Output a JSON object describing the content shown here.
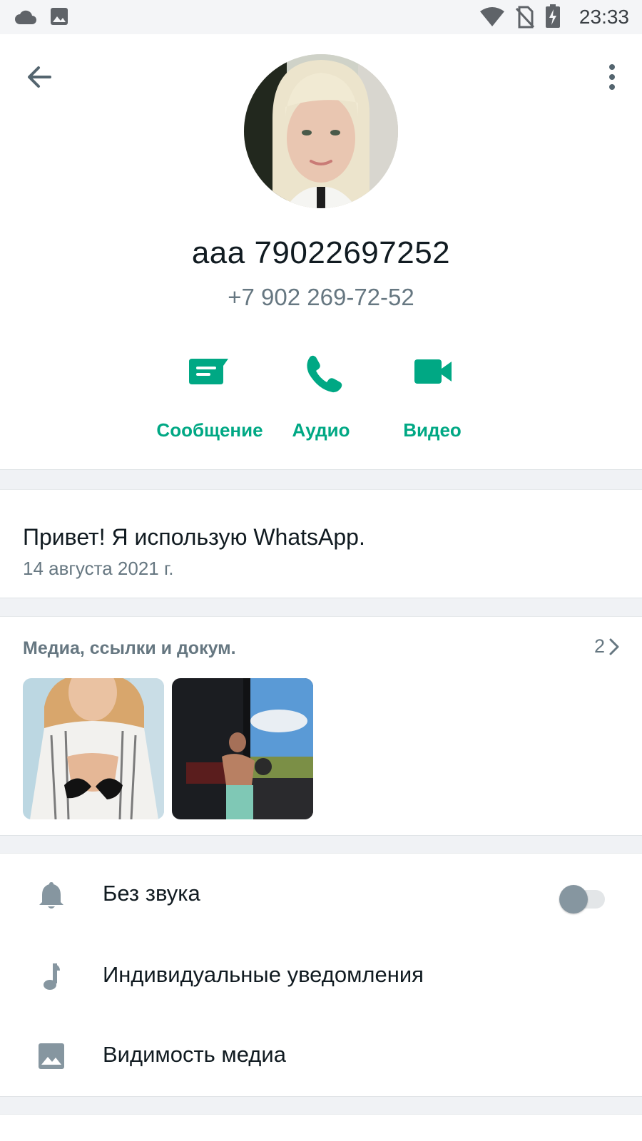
{
  "status_bar": {
    "time": "23:33",
    "left_icons": [
      "cloud-icon",
      "image-icon"
    ],
    "right_icons": [
      "wifi-icon",
      "no-sim-icon",
      "battery-charging-icon"
    ]
  },
  "header": {
    "back_icon": "arrow-left-icon",
    "menu_icon": "more-vert-icon"
  },
  "profile": {
    "name": "aaa 79022697252",
    "phone": "+7 902 269-72-52"
  },
  "actions": [
    {
      "label": "Сообщение",
      "icon": "message-icon"
    },
    {
      "label": "Аудио",
      "icon": "phone-icon"
    },
    {
      "label": "Видео",
      "icon": "videocam-icon"
    }
  ],
  "about": {
    "text": "Привет! Я использую WhatsApp.",
    "date": "14 августа 2021 г."
  },
  "media": {
    "title": "Медиа, ссылки и докум.",
    "count": "2"
  },
  "settings": [
    {
      "label": "Без звука",
      "icon": "bell-icon",
      "toggle_on": false
    },
    {
      "label": "Индивидуальные уведомления",
      "icon": "music-note-icon"
    },
    {
      "label": "Видимость медиа",
      "icon": "image-icon"
    }
  ],
  "colors": {
    "accent": "#00a884",
    "primary_text": "#111b21",
    "secondary_text": "#667781",
    "background": "#f0f2f5"
  }
}
